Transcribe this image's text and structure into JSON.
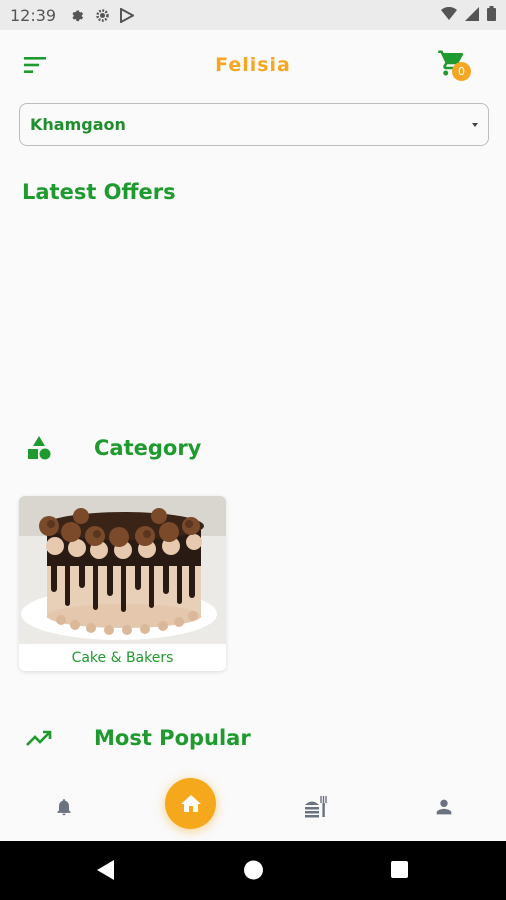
{
  "status_bar": {
    "time": "12:39"
  },
  "app_bar": {
    "title": "Felisia",
    "cart_count": "0"
  },
  "location": {
    "selected": "Khamgaon"
  },
  "sections": {
    "offers_title": "Latest Offers",
    "category_title": "Category",
    "popular_title": "Most Popular"
  },
  "categories": [
    {
      "label": "Cake & Bakers"
    }
  ],
  "colors": {
    "brand_green": "#1f9a2e",
    "accent_orange": "#f5a623"
  },
  "icons": {
    "menu": "sort-lines-icon",
    "cart": "shopping-cart-icon",
    "category": "shapes-icon",
    "popular": "trending-up-icon",
    "nav": [
      "bell-icon",
      "home-icon",
      "food-icon",
      "person-icon"
    ]
  }
}
